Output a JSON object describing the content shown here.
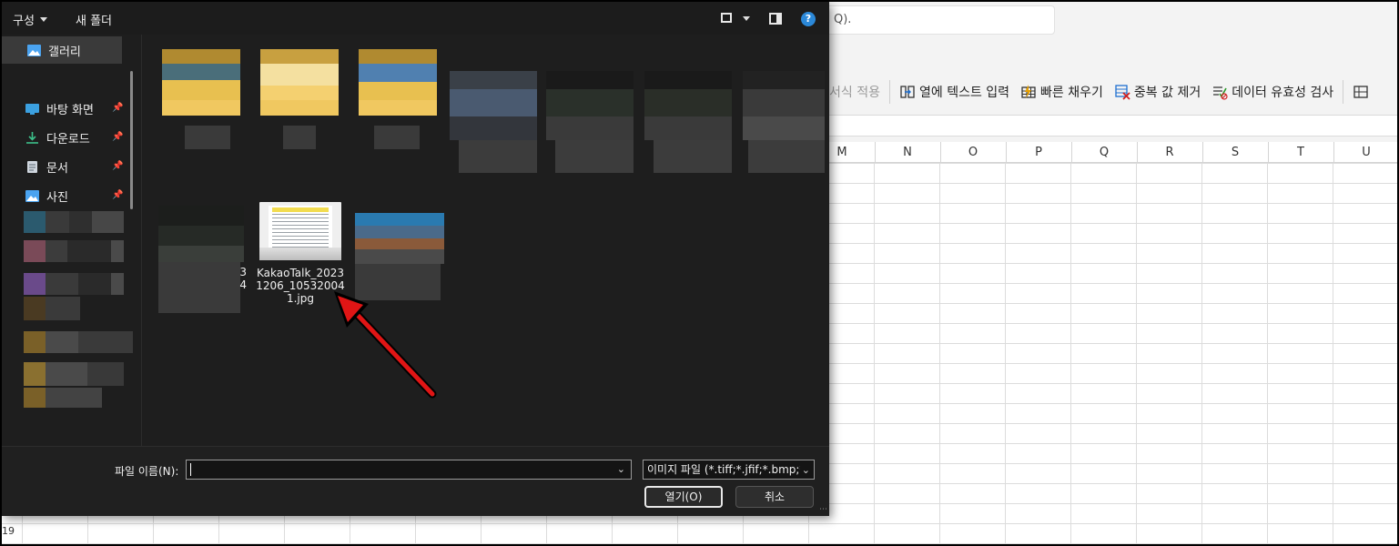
{
  "excel": {
    "search_hint": "Q).",
    "ribbon": [
      {
        "label": "서식 적용",
        "icon": "format-icon",
        "disabled": true
      },
      {
        "label": "열에 텍스트 입력",
        "icon": "text-to-columns-icon",
        "disabled": false
      },
      {
        "label": "빠른 채우기",
        "icon": "flash-fill-icon",
        "disabled": false
      },
      {
        "label": "중복 값 제거",
        "icon": "remove-duplicates-icon",
        "disabled": false
      },
      {
        "label": "데이터 유효성 검사",
        "icon": "data-validation-icon",
        "disabled": false
      }
    ],
    "columns": [
      "M",
      "N",
      "O",
      "P",
      "Q",
      "R",
      "S",
      "T",
      "U"
    ],
    "visible_row_number": "19"
  },
  "dialog": {
    "toolbar": {
      "organize_label": "구성",
      "new_folder_label": "새 폴더",
      "help_glyph": "?"
    },
    "sidebar": {
      "gallery_label": "갤러리",
      "pinned": [
        {
          "label": "바탕 화면",
          "icon": "desktop-icon"
        },
        {
          "label": "다운로드",
          "icon": "download-icon"
        },
        {
          "label": "문서",
          "icon": "document-icon"
        },
        {
          "label": "사진",
          "icon": "pictures-icon"
        }
      ]
    },
    "files": {
      "highlighted": {
        "name_line1": "KakaoTalk_2023",
        "name_line2": "1206_10532004",
        "name_line3": "1.jpg"
      },
      "partial_label_1": "3",
      "partial_label_2": "4"
    },
    "bottom": {
      "filename_label": "파일 이름(N):",
      "filename_value": "",
      "filetype_value": "이미지 파일 (*.tiff;*.jfif;*.bmp;*",
      "open_label": "열기(O)",
      "cancel_label": "취소"
    }
  },
  "colors": {
    "dialog_bg": "#1e1e1e",
    "accent_blue": "#2b88d8",
    "arrow_red": "#e01515"
  }
}
